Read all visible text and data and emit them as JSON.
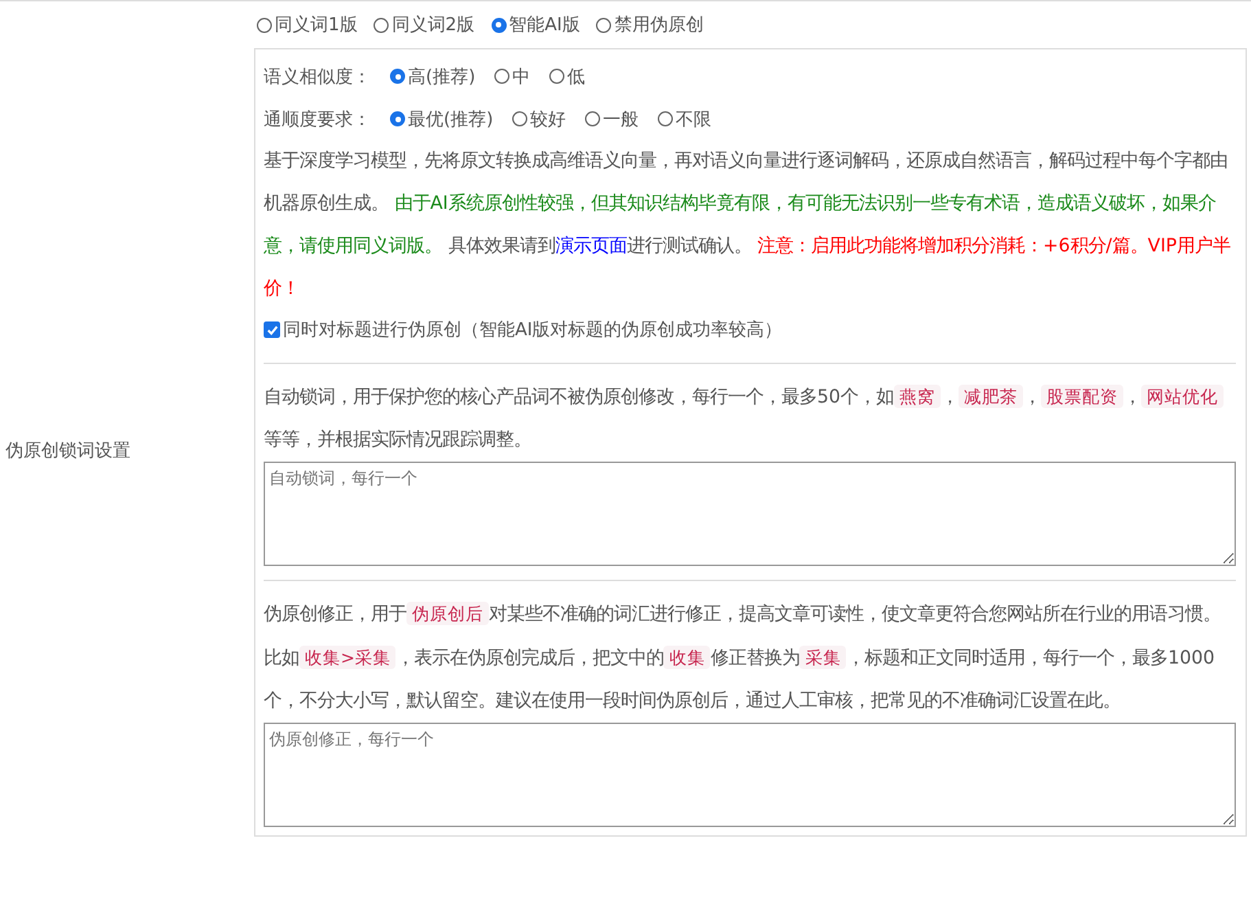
{
  "modes": [
    {
      "label": "同义词1版",
      "selected": false
    },
    {
      "label": "同义词2版",
      "selected": false
    },
    {
      "label": "智能AI版",
      "selected": true
    },
    {
      "label": "禁用伪原创",
      "selected": false
    }
  ],
  "options": [
    {
      "label": "语义相似度：",
      "choices": [
        {
          "label": "高(推荐)",
          "selected": true
        },
        {
          "label": "中",
          "selected": false
        },
        {
          "label": "低",
          "selected": false
        }
      ]
    },
    {
      "label": "通顺度要求：",
      "choices": [
        {
          "label": "最优(推荐)",
          "selected": true
        },
        {
          "label": "较好",
          "selected": false
        },
        {
          "label": "一般",
          "selected": false
        },
        {
          "label": "不限",
          "selected": false
        }
      ]
    }
  ],
  "ai_description": [
    {
      "kind": "text",
      "text": "基于深度学习模型，先将原文转换成高维语义向量，再对语义向量进行逐词解码，还原成自然语言，解码过程中每个字都由机器原创生成。 "
    },
    {
      "kind": "notice",
      "text": "由于AI系统原创性较强，但其知识结构毕竟有限，有可能无法识别一些专有术语，造成语义破坏，如果介意，请使用同义词版。"
    },
    {
      "kind": "text",
      "text": " 具体效果请到"
    },
    {
      "kind": "link",
      "text": "演示页面"
    },
    {
      "kind": "text",
      "text": "进行测试确认。 "
    },
    {
      "kind": "warning",
      "text": "注意：启用此功能将增加积分消耗：+6积分/篇。VIP用户半价！"
    }
  ],
  "title_option": {
    "label": "同时对标题进行伪原创（智能AI版对标题的伪原创成功率较高）",
    "checked": true
  },
  "lock_words": {
    "label": "伪原创锁词设置",
    "description": [
      {
        "kind": "text",
        "text": "自动锁词，用于保护您的核心产品词不被伪原创修改，每行一个，最多50个，如"
      },
      {
        "kind": "tag",
        "text": "燕窝"
      },
      {
        "kind": "text",
        "text": "，"
      },
      {
        "kind": "tag",
        "text": "减肥茶"
      },
      {
        "kind": "text",
        "text": "，"
      },
      {
        "kind": "tag",
        "text": "股票配资"
      },
      {
        "kind": "text",
        "text": "，"
      },
      {
        "kind": "tag",
        "text": "网站优化"
      },
      {
        "kind": "text",
        "text": "等等，并根据实际情况跟踪调整。"
      }
    ],
    "placeholder": "自动锁词，每行一个"
  },
  "corrections": {
    "description": [
      {
        "kind": "text",
        "text": "伪原创修正，用于"
      },
      {
        "kind": "tag",
        "text": "伪原创后"
      },
      {
        "kind": "text",
        "text": "对某些不准确的词汇进行修正，提高文章可读性，使文章更符合您网站所在行业的用语习惯。比如"
      },
      {
        "kind": "tag",
        "text": "收集>采集"
      },
      {
        "kind": "text",
        "text": "，表示在伪原创完成后，把文中的"
      },
      {
        "kind": "tag",
        "text": "收集"
      },
      {
        "kind": "text",
        "text": "修正替换为"
      },
      {
        "kind": "tag",
        "text": "采集"
      },
      {
        "kind": "text",
        "text": "，标题和正文同时适用，每行一个，最多1000个，不分大小写，默认留空。建议在使用一段时间伪原创后，通过人工审核，把常见的不准确词汇设置在此。"
      }
    ],
    "placeholder": "伪原创修正，每行一个"
  }
}
